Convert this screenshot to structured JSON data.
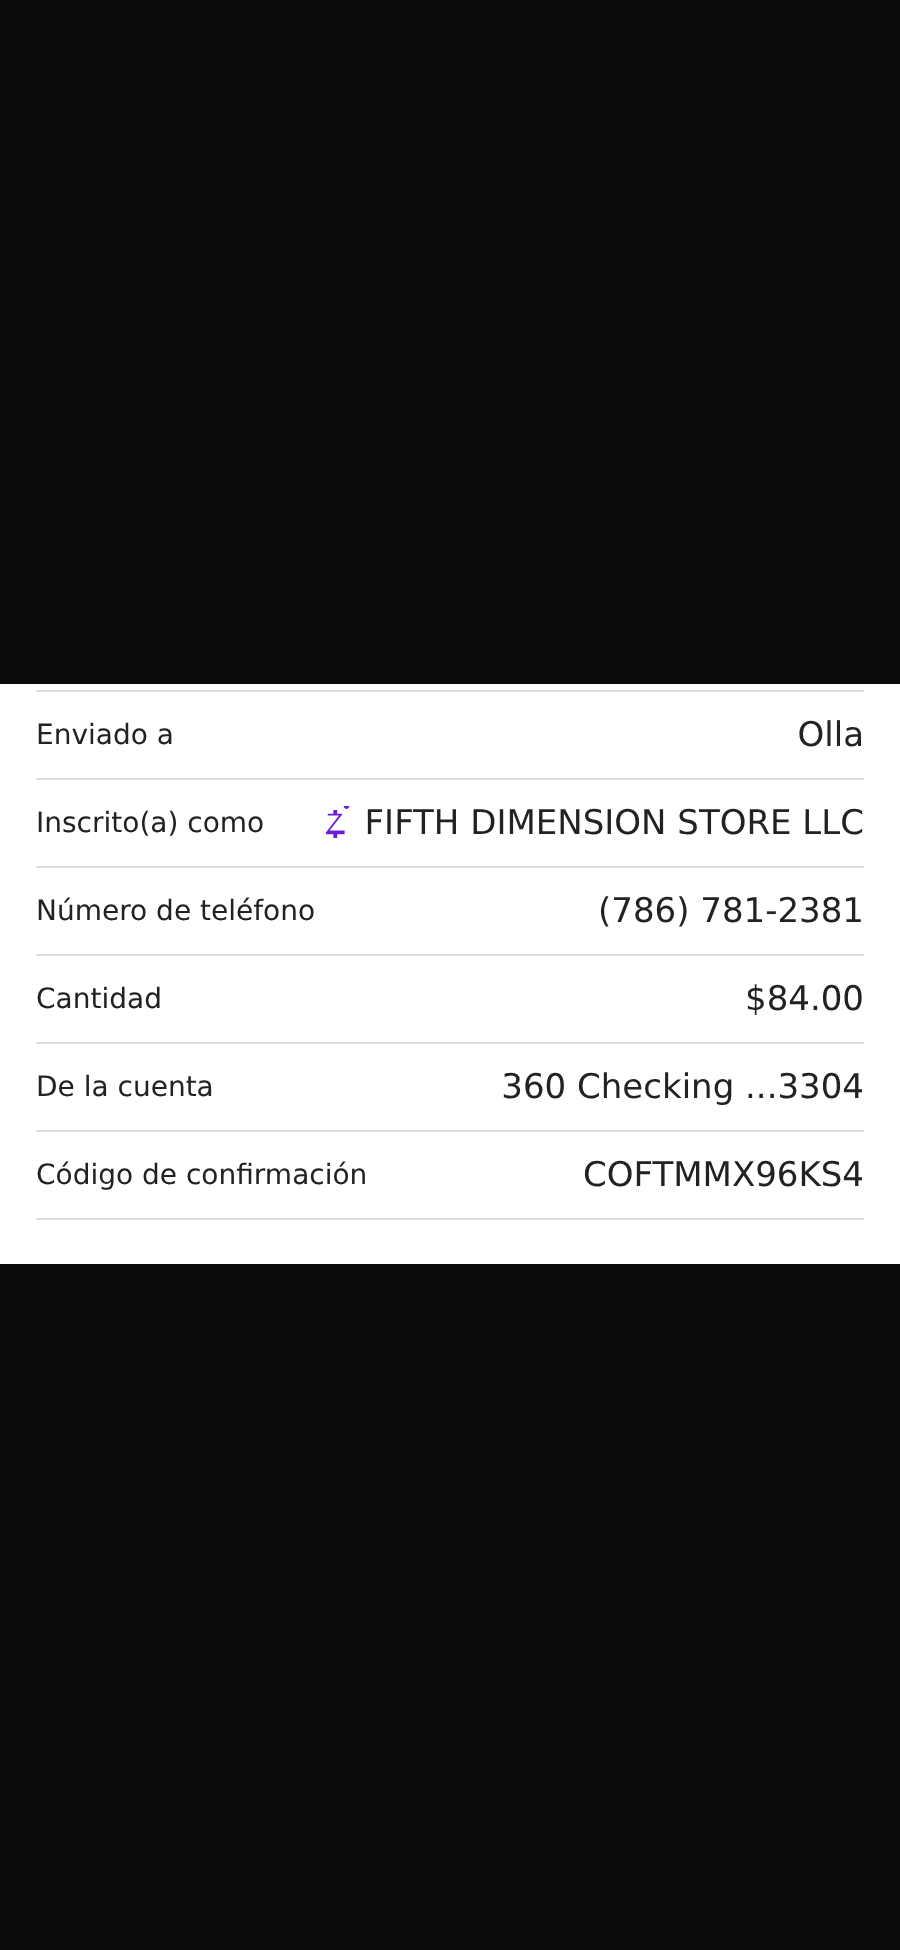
{
  "details": [
    {
      "kind": "plain",
      "label": "Enviado a",
      "value": "Olla"
    },
    {
      "kind": "merchant",
      "label": "Inscrito(a) como",
      "value": "FIFTH DIMENSION STORE LLC"
    },
    {
      "kind": "plain",
      "label": "Número de teléfono",
      "value": "(786) 781-2381"
    },
    {
      "kind": "plain",
      "label": "Cantidad",
      "value": "$84.00"
    },
    {
      "kind": "plain",
      "label": "De la cuenta",
      "value": "360 Checking ...3304"
    },
    {
      "kind": "plain",
      "label": "Código de confirmación",
      "value": "COFTMMX96KS4"
    }
  ]
}
